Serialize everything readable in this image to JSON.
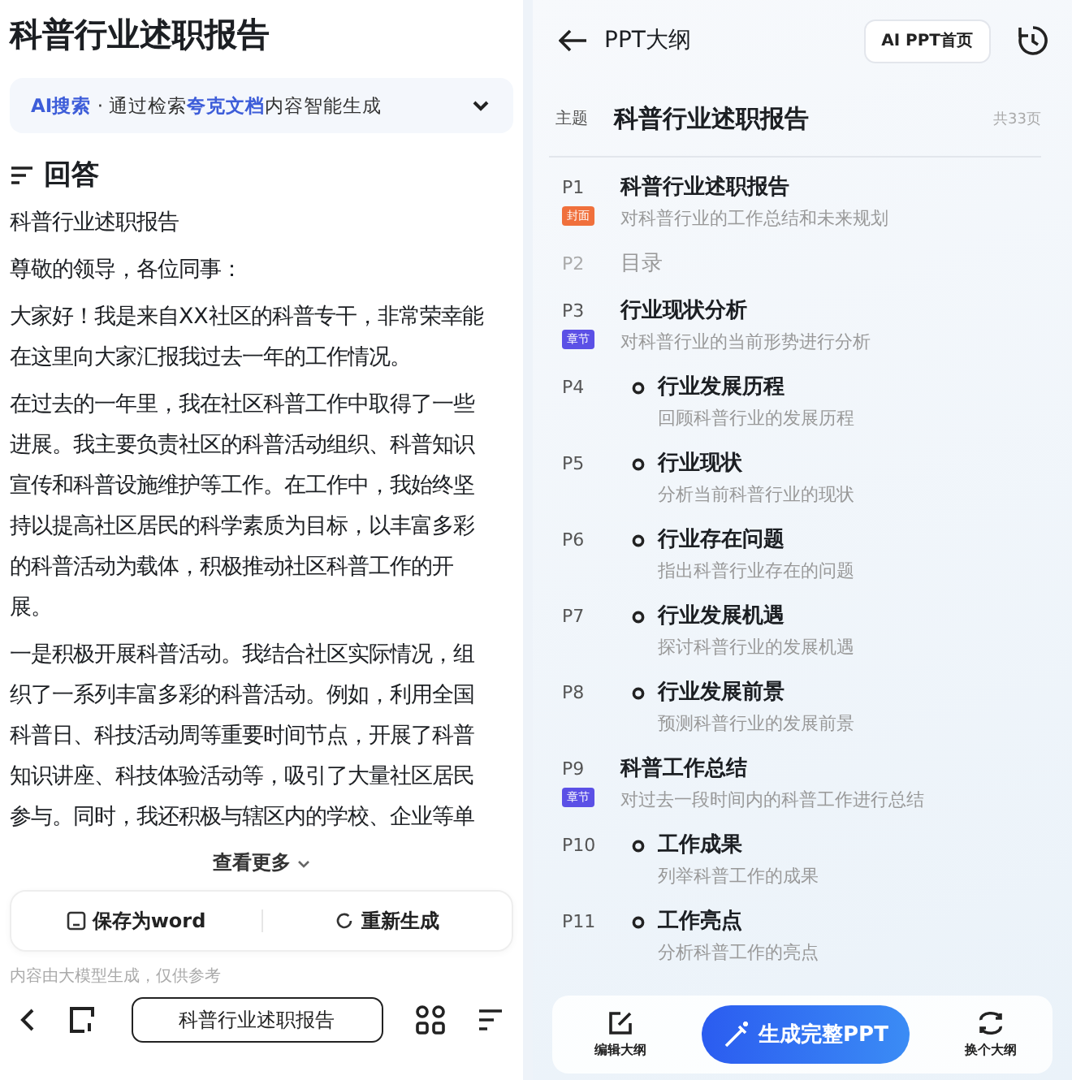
{
  "answer_panel": {
    "title": "科普行业述职报告",
    "search": {
      "accent": "AI",
      "label": "搜索",
      "before": "· 通过检索",
      "link": "夸克文档",
      "after": "内容智能生成"
    },
    "heading": "回答",
    "paragraphs": [
      "科普行业述职报告",
      "尊敬的领导，各位同事：",
      "大家好！我是来自XX社区的科普专干，非常荣幸能在这里向大家汇报我过去一年的工作情况。",
      "在过去的一年里，我在社区科普工作中取得了一些进展。我主要负责社区的科普活动组织、科普知识宣传和科普设施维护等工作。在工作中，我始终坚持以提高社区居民的科学素质为目标，以丰富多彩的科普活动为载体，积极推动社区科普工作的开展。",
      "一是积极开展科普活动。我结合社区实际情况，组织了一系列丰富多彩的科普活动。例如，利用全国科普日、科技活动周等重要时间节点，开展了科普知识讲座、科技体验活动等，吸引了大量社区居民参与。同时，我还积极与辖区内的学校、企业等单"
    ],
    "more": "查看更多",
    "actions": [
      {
        "kind": "save",
        "label": "保存为word"
      },
      {
        "kind": "regenerate",
        "label": "重新生成"
      }
    ],
    "disclaimer": "内容由大模型生成，仅供参考",
    "bottom_bar": {
      "title": "科普行业述职报告"
    }
  },
  "outline_panel": {
    "title": "PPT大纲",
    "home_button": "AI PPT首页",
    "topic": {
      "label": "主题",
      "value": "科普行业述职报告",
      "count": "共33页"
    },
    "items": [
      {
        "page": "P1",
        "kind": "chapter",
        "title": "科普行业述职报告",
        "subtitle": "对科普行业的工作总结和未来规划",
        "tag": "封面",
        "color": "#f0703c"
      },
      {
        "page": "P2",
        "kind": "toc",
        "title": "目录"
      },
      {
        "page": "P3",
        "kind": "chapter",
        "title": "行业现状分析",
        "subtitle": "对科普行业的当前形势进行分析",
        "tag": "章节",
        "color": "#5b50e6"
      },
      {
        "page": "P4",
        "kind": "section",
        "title": "行业发展历程",
        "subtitle": "回顾科普行业的发展历程"
      },
      {
        "page": "P5",
        "kind": "section",
        "title": "行业现状",
        "subtitle": "分析当前科普行业的现状"
      },
      {
        "page": "P6",
        "kind": "section",
        "title": "行业存在问题",
        "subtitle": "指出科普行业存在的问题"
      },
      {
        "page": "P7",
        "kind": "section",
        "title": "行业发展机遇",
        "subtitle": "探讨科普行业的发展机遇"
      },
      {
        "page": "P8",
        "kind": "section",
        "title": "行业发展前景",
        "subtitle": "预测科普行业的发展前景"
      },
      {
        "page": "P9",
        "kind": "chapter",
        "title": "科普工作总结",
        "subtitle": "对过去一段时间内的科普工作进行总结",
        "tag": "章节",
        "color": "#5b50e6"
      },
      {
        "page": "P10",
        "kind": "section",
        "title": "工作成果",
        "subtitle": "列举科普工作的成果"
      },
      {
        "page": "P11",
        "kind": "section",
        "title": "工作亮点",
        "subtitle": "分析科普工作的亮点"
      }
    ],
    "footer": {
      "edit": "编辑大纲",
      "generate": "生成完整PPT",
      "swap": "换个大纲"
    }
  }
}
